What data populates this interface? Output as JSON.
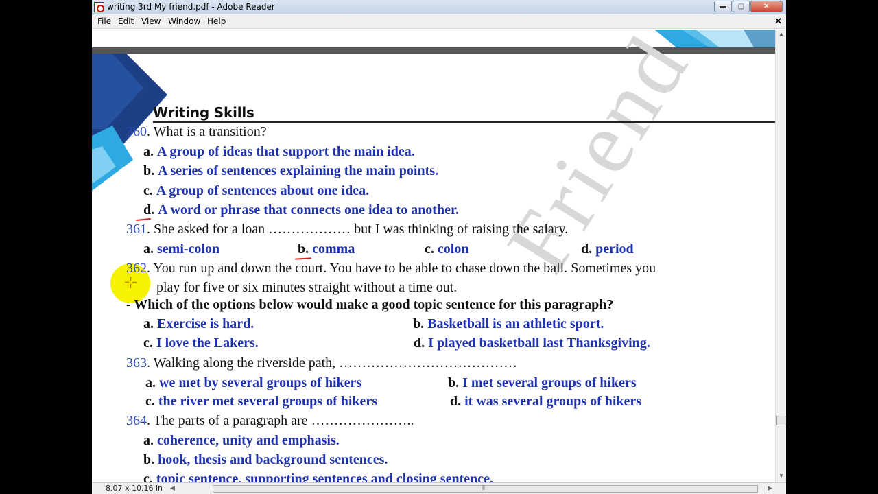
{
  "window": {
    "title": "writing 3rd My friend.pdf - Adobe Reader",
    "minimize": "▬",
    "maximize": "▢",
    "close": "✕"
  },
  "menu": {
    "items": [
      "File",
      "Edit",
      "View",
      "Window",
      "Help"
    ],
    "close_doc": "✕"
  },
  "document": {
    "section_title": "Writing Skills",
    "watermark": "Friend",
    "questions": [
      {
        "number": "360",
        "text": ". What is a transition?",
        "options": [
          {
            "label": "a.",
            "text": "A group of ideas that support the main idea."
          },
          {
            "label": "b.",
            "text": "A series of sentences explaining the main points."
          },
          {
            "label": "c.",
            "text": "A group of sentences about one idea."
          },
          {
            "label": "d.",
            "text": "A word or phrase that connects one idea to another."
          }
        ]
      },
      {
        "number": "361",
        "text": ". She asked for a loan ……………… but I was thinking of raising the salary.",
        "options": [
          {
            "label": "a.",
            "text": "semi-colon"
          },
          {
            "label": "b.",
            "text": "comma"
          },
          {
            "label": "c.",
            "text": "colon"
          },
          {
            "label": "d.",
            "text": "period"
          }
        ]
      },
      {
        "number": "362",
        "text": ". You run up and down the court. You have to be able to chase down the ball. Sometimes you",
        "text_line2": "play for five or six minutes straight without a time out.",
        "prompt": "- Which of the options below would make a good topic sentence for this paragraph?",
        "options": [
          {
            "label": "a.",
            "text": "Exercise is hard."
          },
          {
            "label": "b.",
            "text": "Basketball is an athletic sport."
          },
          {
            "label": "c.",
            "text": "I love the Lakers."
          },
          {
            "label": "d.",
            "text": "I played basketball last Thanksgiving."
          }
        ]
      },
      {
        "number": "363",
        "text": ". Walking along the riverside path, …………………………………",
        "options": [
          {
            "label": "a.",
            "text": "we met by several groups of hikers"
          },
          {
            "label": "b.",
            "text": "I met several groups of hikers"
          },
          {
            "label": "c.",
            "text": "the river met several groups of hikers"
          },
          {
            "label": "d.",
            "text": "it was several groups of hikers"
          }
        ]
      },
      {
        "number": "364",
        "text": ". The parts of a paragraph are …………………..",
        "options": [
          {
            "label": "a.",
            "text": "coherence, unity and emphasis."
          },
          {
            "label": "b.",
            "text": "hook, thesis and background sentences."
          },
          {
            "label": "c.",
            "text": "topic sentence, supporting sentences and closing sentence."
          }
        ]
      }
    ]
  },
  "status": {
    "page_size": "8.07 x 10.16 in"
  },
  "colors": {
    "answer_blue": "#1f33b0",
    "question_number_blue": "#2a49b5",
    "annotation_red": "#d62020",
    "highlight_yellow": "#f7f200"
  }
}
